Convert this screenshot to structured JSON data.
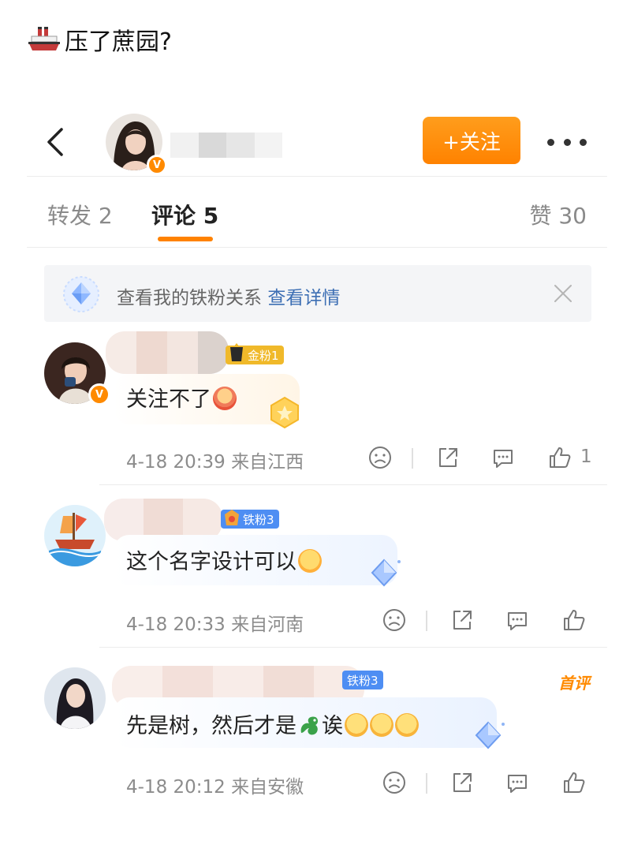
{
  "caption": {
    "text": "压了蔗园?"
  },
  "header": {
    "follow_label": "+关注"
  },
  "tabs": {
    "repost": "转发 2",
    "comments": "评论 5",
    "likes": "赞 30"
  },
  "fan_banner": {
    "text": "查看我的铁粉关系",
    "link": "查看详情"
  },
  "comments": [
    {
      "fan_tag": "金粉1",
      "text": "关注不了",
      "time": "4-18 20:39",
      "location": "来自江西",
      "like_count": "1"
    },
    {
      "fan_tag": "铁粉3",
      "text": "这个名字设计可以",
      "time": "4-18 20:33",
      "location": "来自河南",
      "like_count": ""
    },
    {
      "fan_tag": "铁粉3",
      "text_before": "先是树，然后才是",
      "text_after": "诶",
      "time": "4-18 20:12",
      "location": "来自安徽",
      "badge": "首评",
      "like_count": ""
    }
  ],
  "colors": {
    "accent": "#ff8200",
    "link": "#3d6fb4",
    "gold_tag": "#f0b92a",
    "iron_tag": "#4e8ef3"
  },
  "icons": [
    "ship-icon",
    "back-icon",
    "verified-icon",
    "more-icon",
    "diamond-icon",
    "close-icon",
    "dislike-icon",
    "share-icon",
    "comment-icon",
    "like-icon",
    "dragon-icon"
  ]
}
